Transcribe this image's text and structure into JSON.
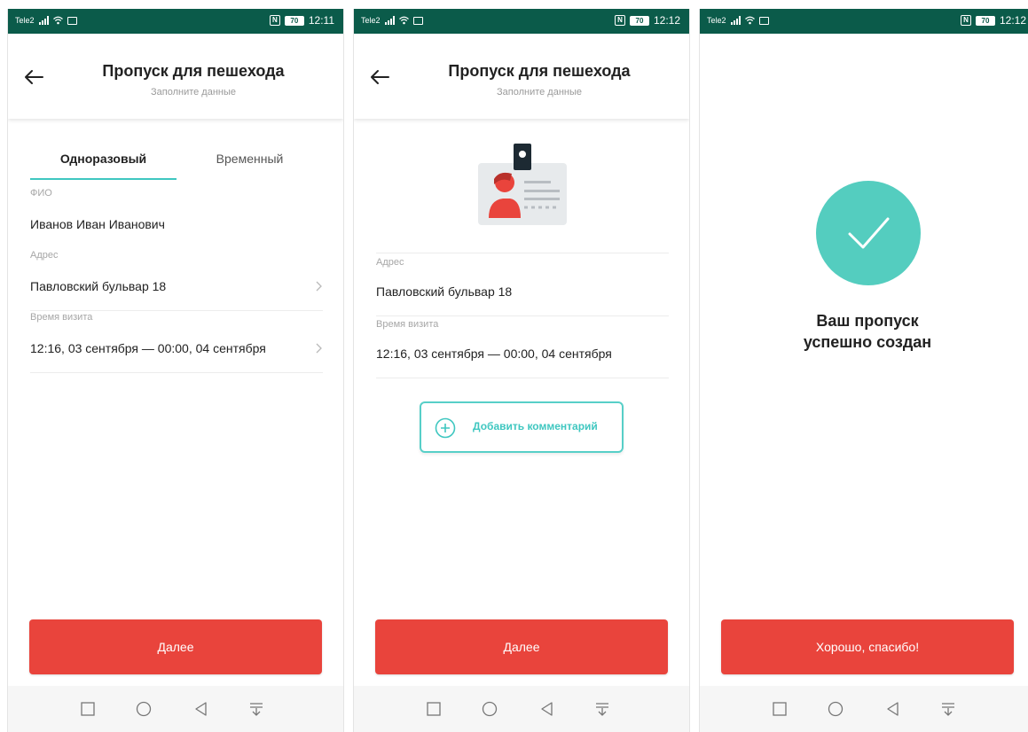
{
  "colors": {
    "statusbar": "#0b5b4a",
    "accent": "#3fc7c0",
    "primary_button": "#e9443c",
    "success_circle": "#54cdbf"
  },
  "screens": [
    {
      "status": {
        "carrier": "Tele2",
        "battery": "70",
        "time": "12:11"
      },
      "header": {
        "title": "Пропуск для пешехода",
        "subtitle": "Заполните данные"
      },
      "tabs": [
        {
          "label": "Одноразовый",
          "active": true
        },
        {
          "label": "Временный",
          "active": false
        }
      ],
      "fields": {
        "name_label": "ФИО",
        "name_value": "Иванов Иван Иванович",
        "address_label": "Адрес",
        "address_value": "Павловский бульвар 18",
        "time_label": "Время визита",
        "time_value": "12:16, 03 сентября — 00:00, 04 сентября"
      },
      "next_button": "Далее"
    },
    {
      "status": {
        "carrier": "Tele2",
        "battery": "70",
        "time": "12:12"
      },
      "header": {
        "title": "Пропуск для пешехода",
        "subtitle": "Заполните данные"
      },
      "illustration_icon": "id-card-icon",
      "fields": {
        "address_label": "Адрес",
        "address_value": "Павловский бульвар 18",
        "time_label": "Время визита",
        "time_value": "12:16, 03 сентября — 00:00, 04 сентября"
      },
      "comment_button": "Добавить комментарий",
      "next_button": "Далее"
    },
    {
      "status": {
        "carrier": "Tele2",
        "battery": "70",
        "time": "12:12"
      },
      "success_icon": "checkmark-icon",
      "success_line1": "Ваш пропуск",
      "success_line2": "успешно создан",
      "ok_button": "Хорошо, спасибо!"
    }
  ]
}
